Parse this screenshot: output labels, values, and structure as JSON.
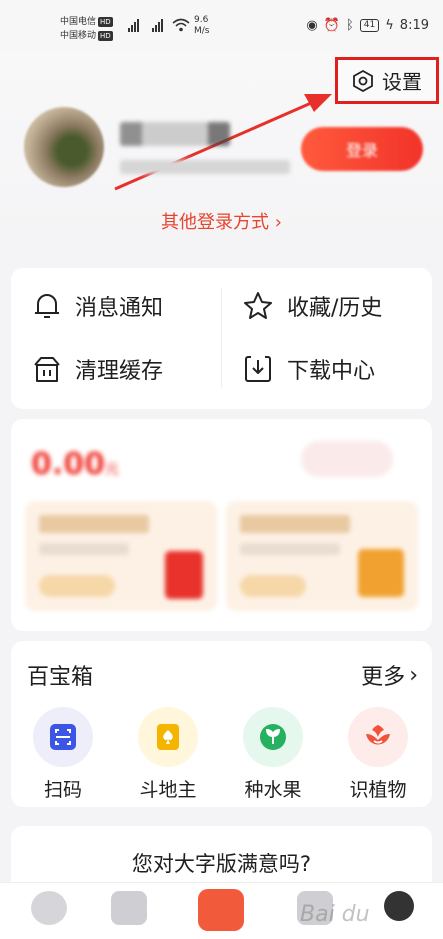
{
  "status_bar": {
    "carrier1": "中国电信",
    "carrier2": "中国移动",
    "hd": "HD",
    "speed_value": "9.6",
    "speed_unit": "M/s",
    "battery": "41",
    "time": "8:19"
  },
  "header": {
    "settings_label": "设置",
    "login_label": "登录",
    "other_login": "其他登录方式 ›"
  },
  "quick_actions": [
    {
      "label": "消息通知",
      "icon": "bell-icon"
    },
    {
      "label": "收藏/历史",
      "icon": "star-icon"
    },
    {
      "label": "清理缓存",
      "icon": "trash-icon"
    },
    {
      "label": "下载中心",
      "icon": "download-icon"
    }
  ],
  "wallet": {
    "amount": "0.00",
    "unit": "元"
  },
  "tools": {
    "title": "百宝箱",
    "more": "更多",
    "items": [
      {
        "label": "扫码",
        "icon": "scan-icon",
        "bg": "#eeeefb",
        "color": "#3b55e6"
      },
      {
        "label": "斗地主",
        "icon": "spade-card-icon",
        "bg": "#fff6dc",
        "color": "#f5b400"
      },
      {
        "label": "种水果",
        "icon": "leaf-icon",
        "bg": "#e6f7ee",
        "color": "#25b15f"
      },
      {
        "label": "识植物",
        "icon": "flower-icon",
        "bg": "#fdecea",
        "color": "#f0523a"
      }
    ]
  },
  "survey": {
    "question": "您对大字版满意吗?"
  },
  "watermark": "Bai du"
}
